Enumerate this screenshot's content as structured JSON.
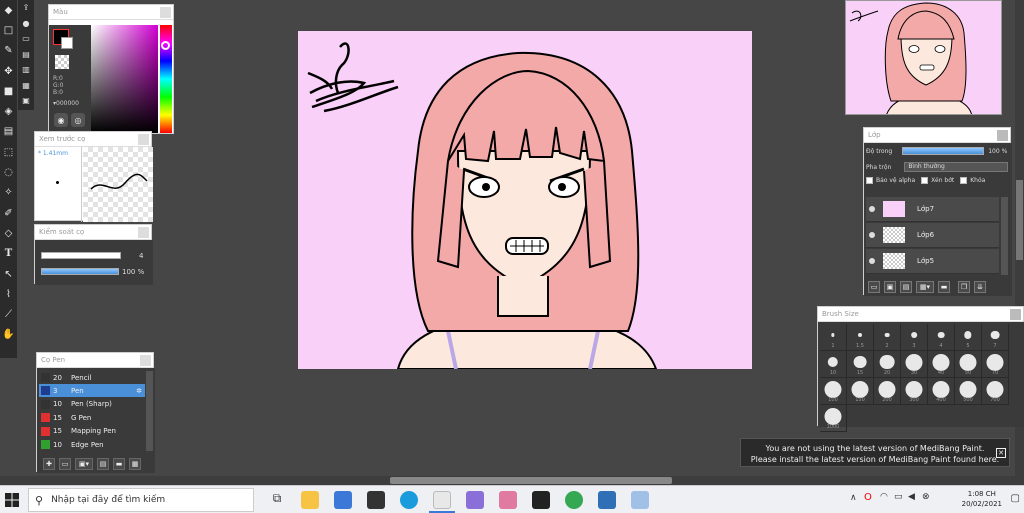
{
  "toolbar": {
    "tools": [
      "eraser-icon",
      "rect-icon",
      "brush-icon",
      "move-icon",
      "fill-rect-icon",
      "bucket-icon",
      "gradient-icon",
      "select-icon",
      "lasso-icon",
      "magic-wand-icon",
      "select-pen-icon",
      "select-eraser-icon",
      "text-icon",
      "operation-icon",
      "eyedropper-icon",
      "divide-icon",
      "hand-icon"
    ],
    "tools2": [
      "export-icon",
      "chat-icon",
      "layers-icon",
      "adjust-icon",
      "color-icon",
      "brush-icon",
      "undo-icon"
    ]
  },
  "color_panel": {
    "title": "Màu",
    "r": "R:0",
    "g": "G:0",
    "b": "B:0",
    "hex": "▾000000"
  },
  "brush_preview": {
    "title": "Xem trước cọ",
    "size": "* 1.41mm"
  },
  "brush_control": {
    "title": "Kiểm soát cọ",
    "size_value": "4",
    "opacity_value": "100 %",
    "size_fill": 0.82,
    "opacity_fill": 1.0
  },
  "brush_list": {
    "title": "Cọ Pen",
    "items": [
      {
        "size": "20",
        "name": "Pencil",
        "color": "#333333"
      },
      {
        "size": "3",
        "name": "Pen",
        "color": "#1e3d8f",
        "selected": true
      },
      {
        "size": "10",
        "name": "Pen (Sharp)",
        "color": "#333333"
      },
      {
        "size": "15",
        "name": "G Pen",
        "color": "#e03030"
      },
      {
        "size": "15",
        "name": "Mapping Pen",
        "color": "#e03030"
      },
      {
        "size": "10",
        "name": "Edge Pen",
        "color": "#30a030"
      }
    ]
  },
  "layer_panel": {
    "title": "Lớp",
    "opacity_label": "Độ trong",
    "opacity_value": "100 %",
    "blend_label": "Pha trộn",
    "blend_value": "Bình thường",
    "protect_alpha": "Bảo vệ alpha",
    "clipping": "Xén bớt",
    "lock": "Khóa",
    "layers": [
      "Lớp7",
      "Lớp6",
      "Lớp5"
    ]
  },
  "brush_size": {
    "title": "Brush Size",
    "sizes": [
      "1",
      "1.5",
      "2",
      "3",
      "4",
      "5",
      "7",
      "10",
      "15",
      "20",
      "30",
      "40",
      "50",
      "70",
      "100",
      "150",
      "200",
      "300",
      "400",
      "500",
      "700",
      "1000"
    ]
  },
  "notice": {
    "line1": "You are not using the latest version of MediBang Paint.",
    "line2": "Please install the latest version of MediBang Paint found here.",
    "close": "✕"
  },
  "taskbar": {
    "search_placeholder": "Nhập tại đây để tìm kiếm",
    "time": "1:08 CH",
    "date": "20/02/2021"
  }
}
